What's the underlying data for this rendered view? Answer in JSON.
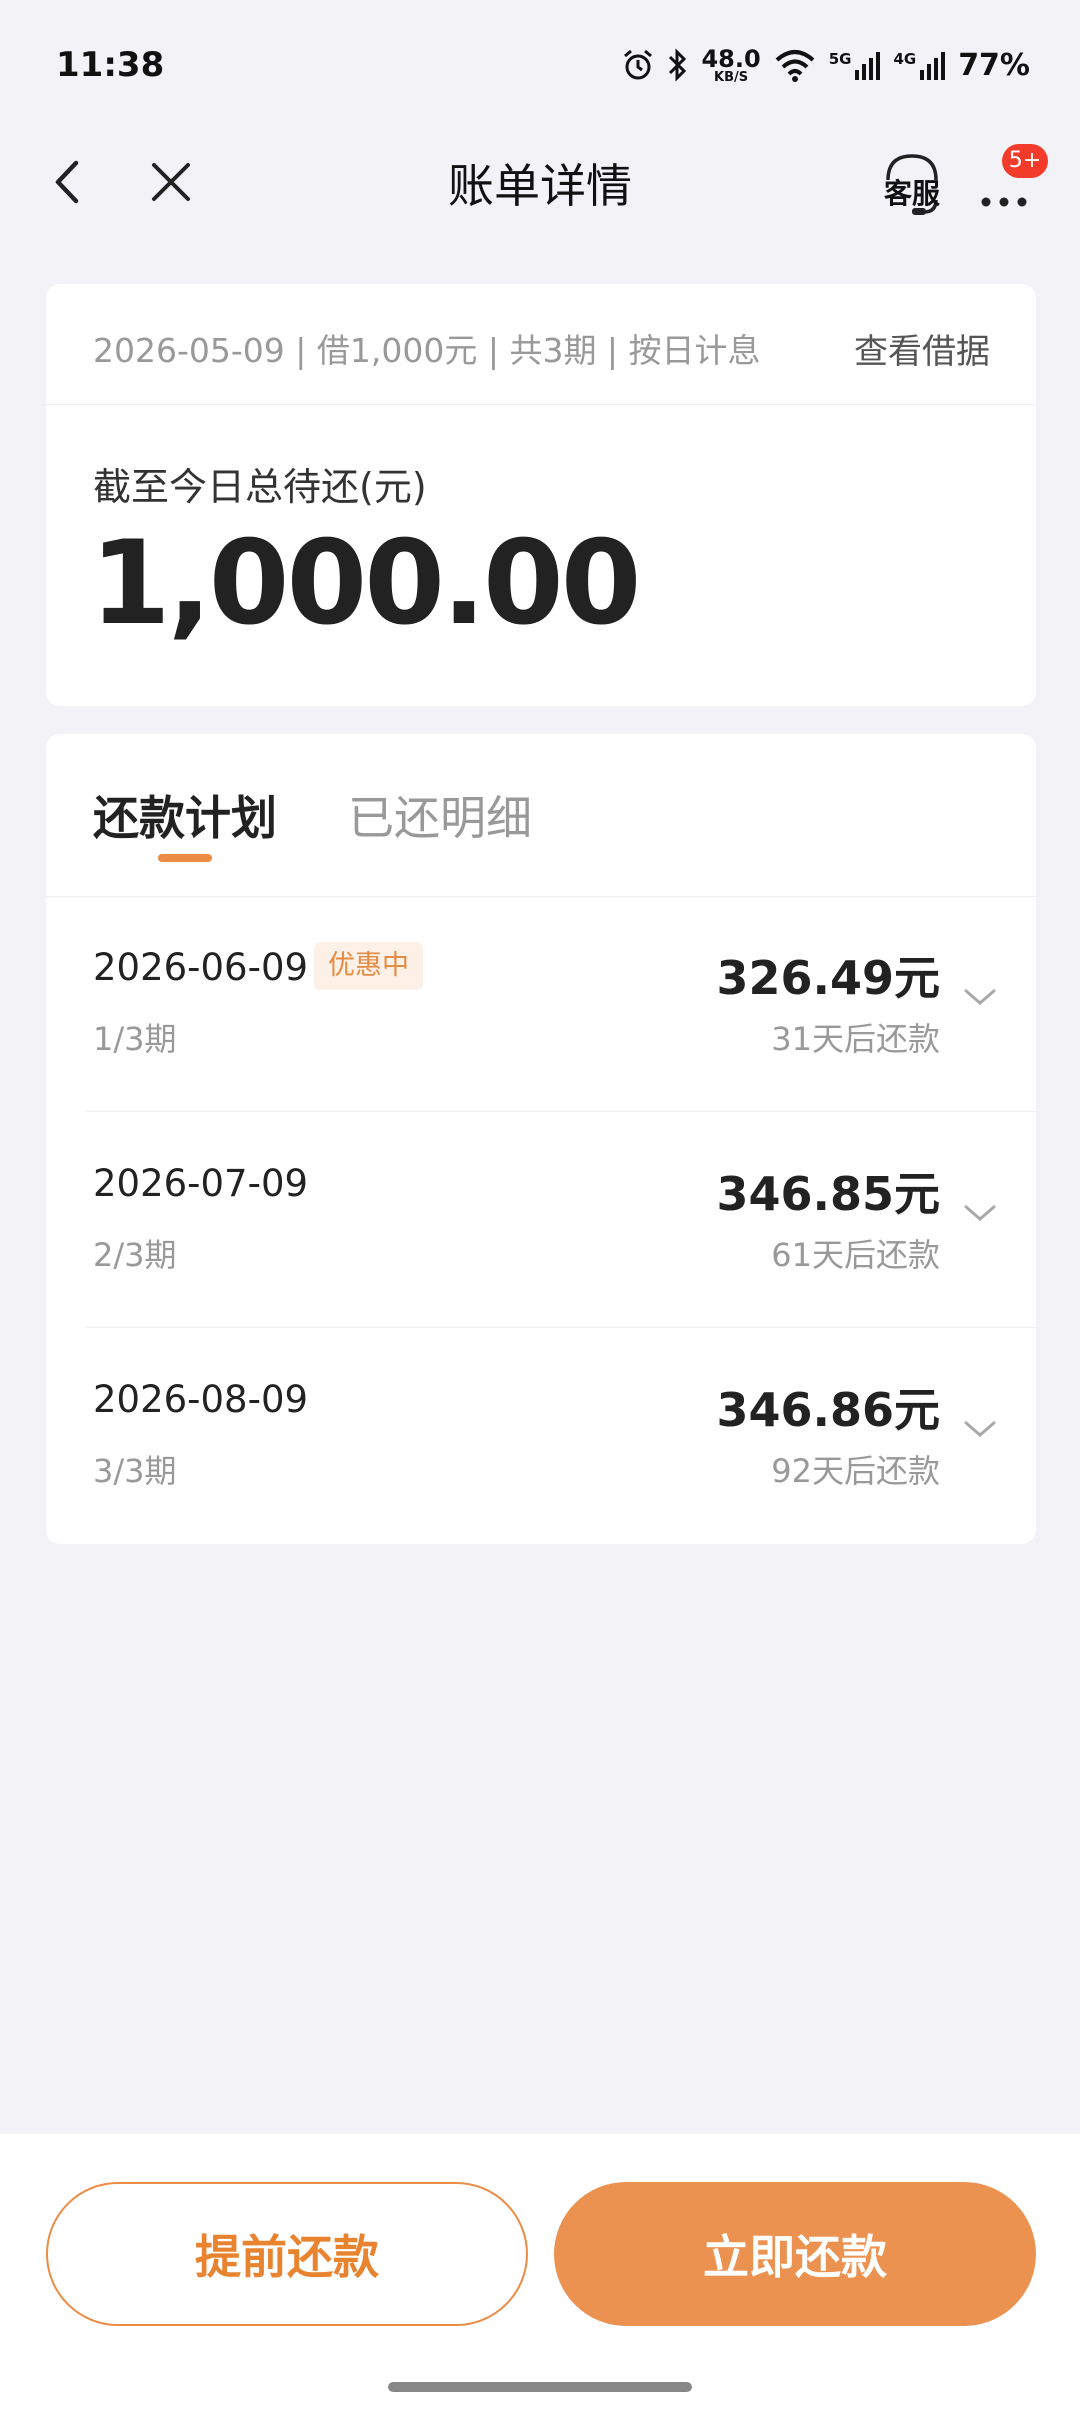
{
  "status_bar": {
    "time": "11:38",
    "net_speed_value": "48.0",
    "net_speed_unit": "KB/S",
    "signal1_label": "5G",
    "signal2_label": "4G",
    "battery": "77%"
  },
  "nav": {
    "title": "账单详情",
    "service_label": "客服",
    "more_badge": "5+"
  },
  "loan": {
    "info": "2026-05-09 | 借1,000元 | 共3期 | 按日计息",
    "view_receipt": "查看借据",
    "total_label": "截至今日总待还(元)",
    "total_amount": "1,000.00"
  },
  "tabs": {
    "plan": "还款计划",
    "paid": "已还明细"
  },
  "installments": [
    {
      "date": "2026-06-09",
      "badge": "优惠中",
      "period": "1/3期",
      "amount": "326.49元",
      "due": "31天后还款"
    },
    {
      "date": "2026-07-09",
      "badge": "",
      "period": "2/3期",
      "amount": "346.85元",
      "due": "61天后还款"
    },
    {
      "date": "2026-08-09",
      "badge": "",
      "period": "3/3期",
      "amount": "346.86元",
      "due": "92天后还款"
    }
  ],
  "buttons": {
    "early": "提前还款",
    "now": "立即还款"
  },
  "colors": {
    "accent": "#ec9250",
    "badge_red": "#f23b2b",
    "background": "#f2f2f7"
  }
}
